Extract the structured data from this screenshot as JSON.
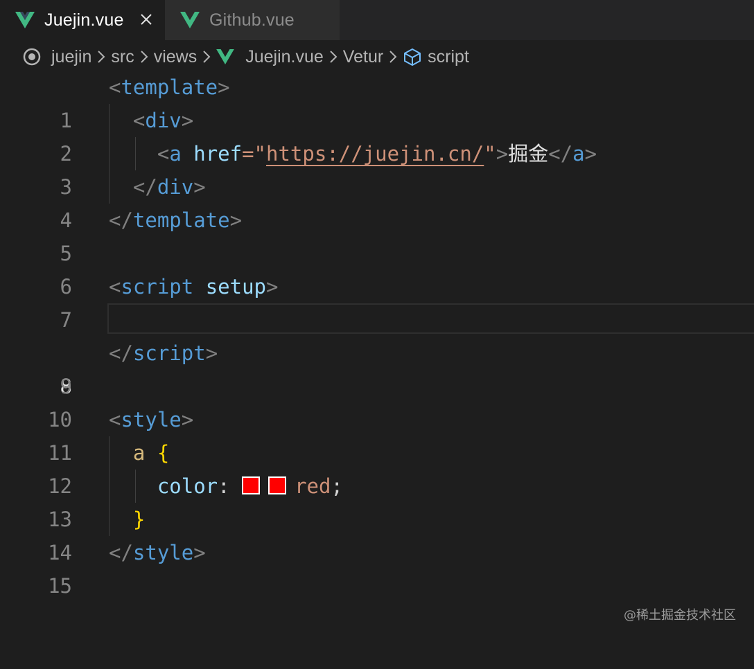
{
  "tabs": [
    {
      "label": "Juejin.vue",
      "active": true
    },
    {
      "label": "Github.vue",
      "active": false
    }
  ],
  "breadcrumb": {
    "items": [
      "juejin",
      "src",
      "views",
      "Juejin.vue",
      "Vetur",
      "script"
    ]
  },
  "code": {
    "line_numbers": [
      "1",
      "2",
      "3",
      "4",
      "5",
      "6",
      "7",
      "8",
      "9",
      "10",
      "11",
      "12",
      "13",
      "14",
      "15"
    ],
    "current_line": "8",
    "tokens": {
      "lt": "<",
      "gt": ">",
      "lt_slash": "</",
      "template": "template",
      "div": "div",
      "a": "a",
      "href": "href",
      "eq_quote": "=\"",
      "url": "https://juejin.cn/",
      "quote": "\"",
      "link_text": "掘金",
      "script": "script",
      "setup": "setup",
      "style": "style",
      "selector": "a",
      "brace_open": "{",
      "brace_close": "}",
      "prop": "color",
      "colon": ":",
      "value": "red",
      "semicolon": ";"
    }
  },
  "watermark": "@稀土掘金技术社区",
  "colors": {
    "vue_green": "#41b883",
    "swatch": "#ff0000"
  }
}
